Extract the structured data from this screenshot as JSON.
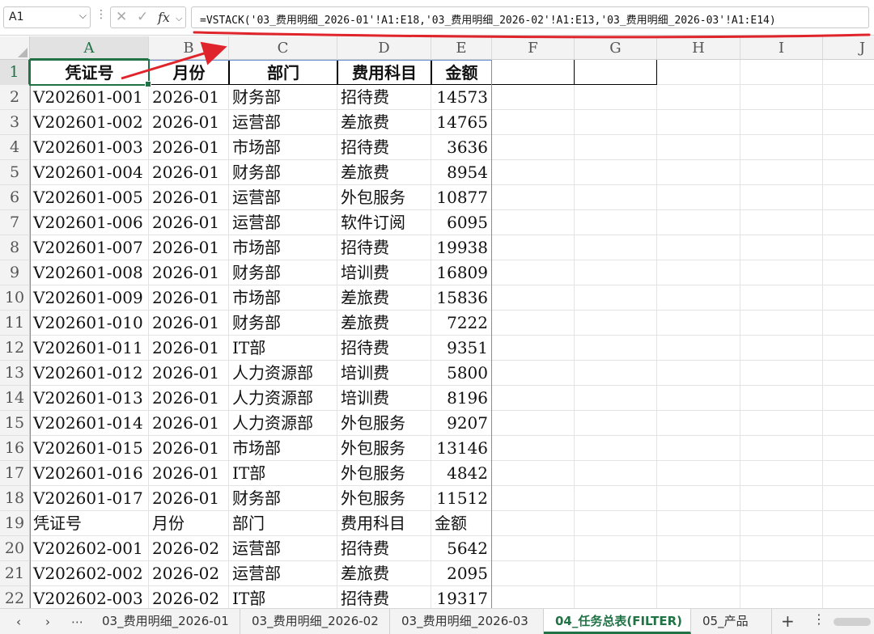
{
  "formula_bar": {
    "name_box": "A1",
    "formula": "=VSTACK('03_费用明细_2026-01'!A1:E18,'03_费用明细_2026-02'!A1:E13,'03_费用明细_2026-03'!A1:E14)",
    "fx_label": "fx"
  },
  "columns": [
    "A",
    "B",
    "C",
    "D",
    "E",
    "F",
    "G",
    "H",
    "I",
    "J"
  ],
  "rows": [
    [
      "凭证号",
      "月份",
      "部门",
      "费用科目",
      "金额"
    ],
    [
      "V202601-001",
      "2026-01",
      "财务部",
      "招待费",
      "14573"
    ],
    [
      "V202601-002",
      "2026-01",
      "运营部",
      "差旅费",
      "14765"
    ],
    [
      "V202601-003",
      "2026-01",
      "市场部",
      "招待费",
      "3636"
    ],
    [
      "V202601-004",
      "2026-01",
      "财务部",
      "差旅费",
      "8954"
    ],
    [
      "V202601-005",
      "2026-01",
      "运营部",
      "外包服务",
      "10877"
    ],
    [
      "V202601-006",
      "2026-01",
      "运营部",
      "软件订阅",
      "6095"
    ],
    [
      "V202601-007",
      "2026-01",
      "市场部",
      "招待费",
      "19938"
    ],
    [
      "V202601-008",
      "2026-01",
      "财务部",
      "培训费",
      "16809"
    ],
    [
      "V202601-009",
      "2026-01",
      "市场部",
      "差旅费",
      "15836"
    ],
    [
      "V202601-010",
      "2026-01",
      "财务部",
      "差旅费",
      "7222"
    ],
    [
      "V202601-011",
      "2026-01",
      "IT部",
      "招待费",
      "9351"
    ],
    [
      "V202601-012",
      "2026-01",
      "人力资源部",
      "培训费",
      "5800"
    ],
    [
      "V202601-013",
      "2026-01",
      "人力资源部",
      "培训费",
      "8196"
    ],
    [
      "V202601-014",
      "2026-01",
      "人力资源部",
      "外包服务",
      "9207"
    ],
    [
      "V202601-015",
      "2026-01",
      "市场部",
      "外包服务",
      "13146"
    ],
    [
      "V202601-016",
      "2026-01",
      "IT部",
      "外包服务",
      "4842"
    ],
    [
      "V202601-017",
      "2026-01",
      "财务部",
      "外包服务",
      "11512"
    ],
    [
      "凭证号",
      "月份",
      "部门",
      "费用科目",
      "金额"
    ],
    [
      "V202602-001",
      "2026-02",
      "运营部",
      "招待费",
      "5642"
    ],
    [
      "V202602-002",
      "2026-02",
      "运营部",
      "差旅费",
      "2095"
    ],
    [
      "V202602-003",
      "2026-02",
      "IT部",
      "招待费",
      "19317"
    ]
  ],
  "sheet_tabs": [
    {
      "label": "03_费用明细_2026-01",
      "active": false
    },
    {
      "label": "03_费用明细_2026-02",
      "active": false
    },
    {
      "label": "03_费用明细_2026-03",
      "active": false
    },
    {
      "label": "04_任务总表(FILTER)",
      "active": true
    },
    {
      "label": "05_产品",
      "active": false
    }
  ],
  "annotation_color": "#e0242b",
  "accent_color": "#217346"
}
